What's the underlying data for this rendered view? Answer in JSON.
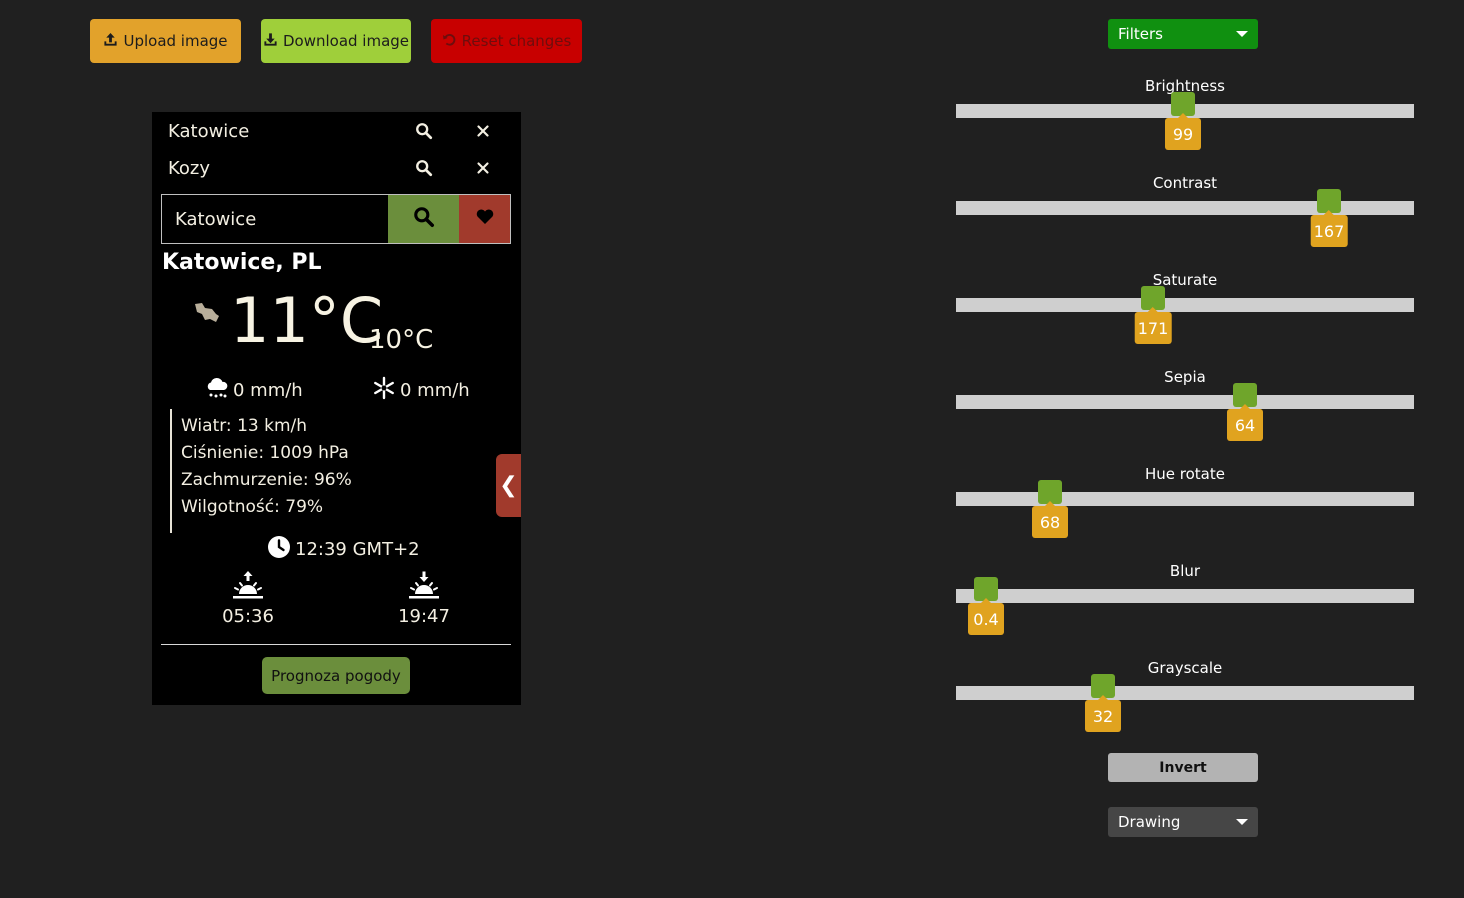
{
  "toolbar": {
    "upload_label": "Upload image",
    "download_label": "Download image",
    "reset_label": "Reset changes"
  },
  "weather": {
    "favorites": [
      {
        "name": "Katowice"
      },
      {
        "name": "Kozy"
      }
    ],
    "search_value": "Katowice",
    "city": "Katowice, PL",
    "temperature": "11°C",
    "feels_like": "10°C",
    "rain": "0 mm/h",
    "snow": "0 mm/h",
    "details": {
      "wind": "Wiatr: 13 km/h",
      "pressure": "Ciśnienie: 1009 hPa",
      "clouds": "Zachmurzenie: 96%",
      "humidity": "Wilgotność: 79%"
    },
    "time": "12:39 GMT+2",
    "sunrise": "05:36",
    "sunset": "19:47",
    "forecast_button": "Prognoza pogody",
    "collapse_glyph": "❮"
  },
  "filters": {
    "dropdown_label": "Filters",
    "sliders": [
      {
        "label": "Brightness",
        "value": "99",
        "fraction": 0.495
      },
      {
        "label": "Contrast",
        "value": "167",
        "fraction": 0.815
      },
      {
        "label": "Saturate",
        "value": "171",
        "fraction": 0.43
      },
      {
        "label": "Sepia",
        "value": "64",
        "fraction": 0.63
      },
      {
        "label": "Hue rotate",
        "value": "68",
        "fraction": 0.205
      },
      {
        "label": "Blur",
        "value": "0.4",
        "fraction": 0.065
      },
      {
        "label": "Grayscale",
        "value": "32",
        "fraction": 0.32
      }
    ],
    "invert_label": "Invert",
    "drawing_label": "Drawing"
  },
  "colors": {
    "upload": "#e2a22b",
    "download": "#9fcf3a",
    "reset": "#c80000",
    "filters_dropdown": "#109010",
    "slider_thumb": "#6fa52b",
    "slider_value": "#e0a31f"
  }
}
